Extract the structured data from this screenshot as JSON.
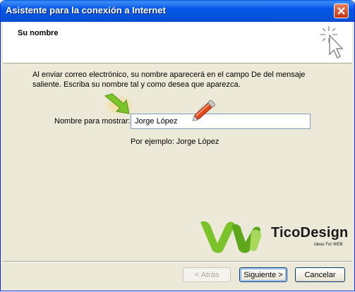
{
  "window": {
    "title": "Asistente para la conexión a Internet"
  },
  "header": {
    "title": "Su nombre"
  },
  "content": {
    "description": "Al enviar correo electrónico, su nombre aparecerá en el campo De del mensaje saliente. Escriba su nombre tal y como desea que aparezca.",
    "field_label": "Nombre para mostrar:",
    "field_value": "Jorge López",
    "example_text": "Por ejemplo: Jorge López"
  },
  "logo": {
    "name": "TicoDesign",
    "tagline": "Ideas For WEB"
  },
  "footer": {
    "back_label": "< Atrás",
    "next_label": "Siguiente >",
    "cancel_label": "Cancelar"
  },
  "colors": {
    "titlebar": "#0758e8",
    "accent_green": "#6bbf1f",
    "pen_red": "#e24a1e"
  },
  "icons": [
    "close-icon",
    "wizard-cursor-icon",
    "green-arrow-icon",
    "pen-icon",
    "ticodesign-logo-icon"
  ]
}
